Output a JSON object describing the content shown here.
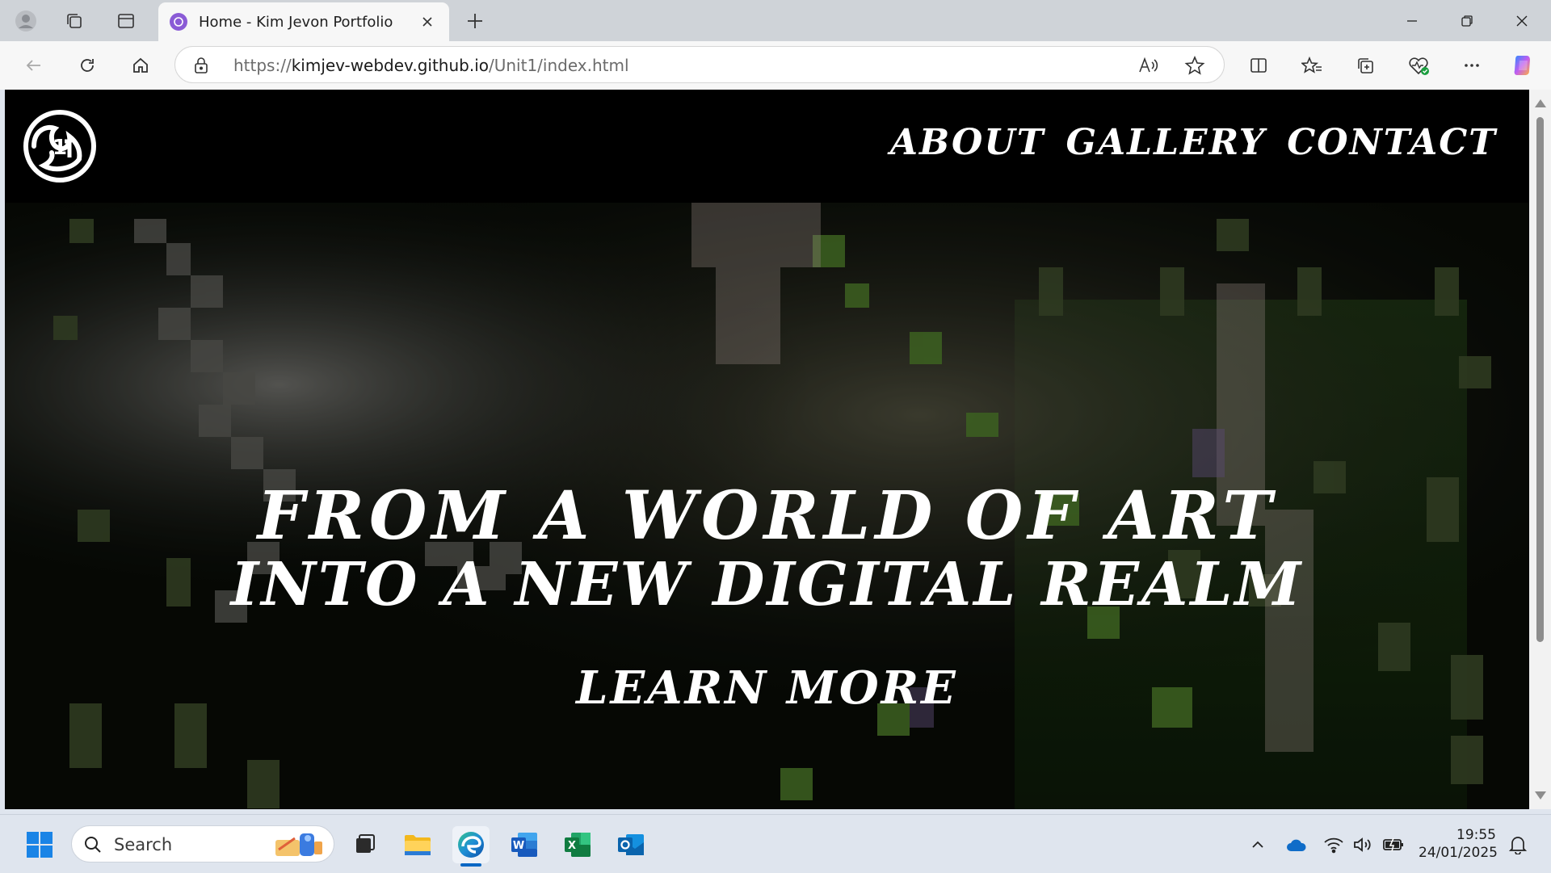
{
  "browser": {
    "tab": {
      "title": "Home - Kim Jevon Portfolio"
    },
    "address": {
      "scheme": "https://",
      "host": "kimjev-webdev.github.io",
      "path": "/Unit1/index.html"
    }
  },
  "site": {
    "nav": [
      "ABOUT",
      "GALLERY",
      "CONTACT"
    ],
    "hero": {
      "line1": "FROM A WORLD OF ART",
      "line2": "INTO A NEW DIGITAL REALM",
      "cta": "LEARN MORE"
    }
  },
  "taskbar": {
    "search_placeholder": "Search",
    "time": "19:55",
    "date": "24/01/2025"
  },
  "colors": {
    "page_background": "#000000",
    "text": "#ffffff",
    "accent": "#0a67c4"
  }
}
